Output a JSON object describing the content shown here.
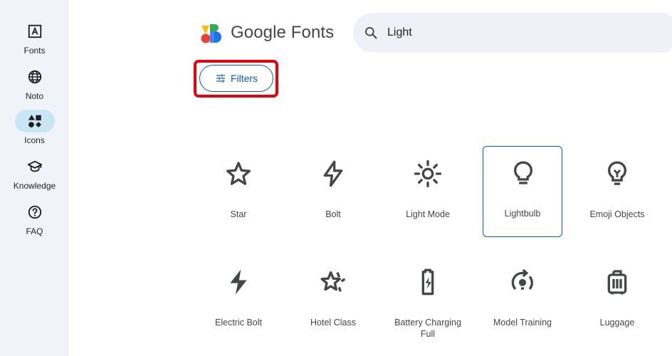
{
  "sidebar": {
    "items": [
      {
        "label": "Fonts",
        "icon": "font-icon"
      },
      {
        "label": "Noto",
        "icon": "globe-icon"
      },
      {
        "label": "Icons",
        "icon": "shapes-icon",
        "active": true
      },
      {
        "label": "Knowledge",
        "icon": "school-icon"
      },
      {
        "label": "FAQ",
        "icon": "help-icon"
      }
    ]
  },
  "header": {
    "logo_text": "Google Fonts",
    "search_value": "Light"
  },
  "filters": {
    "label": "Filters"
  },
  "icons": [
    {
      "label": "Star",
      "icon": "star-icon"
    },
    {
      "label": "Bolt",
      "icon": "bolt-icon"
    },
    {
      "label": "Light Mode",
      "icon": "light-mode-icon"
    },
    {
      "label": "Lightbulb",
      "icon": "lightbulb-icon",
      "selected": true
    },
    {
      "label": "Emoji Objects",
      "icon": "emoji-objects-icon"
    },
    {
      "label": "Electric Bolt",
      "icon": "electric-bolt-icon"
    },
    {
      "label": "Hotel Class",
      "icon": "hotel-class-icon"
    },
    {
      "label": "Battery Charging Full",
      "icon": "battery-charging-full-icon"
    },
    {
      "label": "Model Training",
      "icon": "model-training-icon"
    },
    {
      "label": "Luggage",
      "icon": "luggage-icon"
    }
  ],
  "colors": {
    "accent": "#0b57d0",
    "highlight": "#e8000b",
    "sidebar_bg": "#f0f4f9",
    "icon": "#444746"
  }
}
